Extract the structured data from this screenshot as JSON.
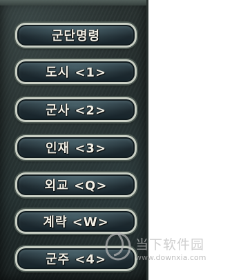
{
  "menu": {
    "items": [
      {
        "label": "군단명령"
      },
      {
        "label": "도시 <1>"
      },
      {
        "label": "군사 <2>"
      },
      {
        "label": "인재 <3>"
      },
      {
        "label": "외교 <Q>"
      },
      {
        "label": "계략 <W>"
      },
      {
        "label": "군주 <4>"
      }
    ]
  },
  "watermark": {
    "title": "当下软件园",
    "url": "www.downxia.com",
    "logo_icon": "downxia-logo-icon"
  },
  "colors": {
    "panel": "#1f2726",
    "button_fill": "#1e2a30",
    "button_border": "#c9cfc4",
    "label": "#f2f0e6",
    "watermark": "#bebebe"
  }
}
